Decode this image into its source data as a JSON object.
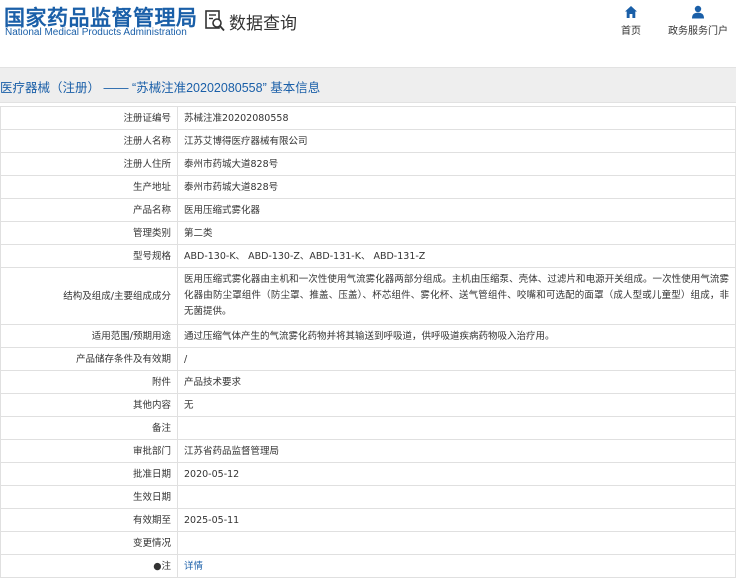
{
  "header": {
    "org_name": "国家药品监督管理局",
    "org_name_en": "National Medical Products Administration",
    "query_label": "数据查询",
    "nav": [
      {
        "label": "首页",
        "icon": "home-icon"
      },
      {
        "label": "政务服务门户",
        "icon": "user-icon"
      }
    ]
  },
  "title": "医疗器械（注册） —— “苏械注准20202080558” 基本信息",
  "colors": {
    "brand_blue": "#1a5fa8",
    "title_bg": "#eeeeee",
    "border": "#e0e0e0"
  },
  "record": [
    {
      "label": "注册证编号",
      "value": "苏械注准20202080558"
    },
    {
      "label": "注册人名称",
      "value": "江苏艾博得医疗器械有限公司"
    },
    {
      "label": "注册人住所",
      "value": "泰州市药城大道828号"
    },
    {
      "label": "生产地址",
      "value": "泰州市药城大道828号"
    },
    {
      "label": "产品名称",
      "value": "医用压缩式雾化器"
    },
    {
      "label": "管理类别",
      "value": "第二类"
    },
    {
      "label": "型号规格",
      "value": "ABD-130-K、 ABD-130-Z、ABD-131-K、 ABD-131-Z"
    },
    {
      "label": "结构及组成/主要组成成分",
      "value": "医用压缩式雾化器由主机和一次性使用气流雾化器两部分组成。主机由压缩泵、壳体、过滤片和电源开关组成。一次性使用气流雾化器由防尘罩组件（防尘罩、推盖、压盖）、杯芯组件、雾化杯、送气管组件、咬嘴和可选配的面罩（成人型或儿童型）组成，非无菌提供。"
    },
    {
      "label": "适用范围/预期用途",
      "value": "通过压缩气体产生的气流雾化药物并将其输送到呼吸道，供呼吸道疾病药物吸入治疗用。"
    },
    {
      "label": "产品储存条件及有效期",
      "value": "/"
    },
    {
      "label": "附件",
      "value": "产品技术要求"
    },
    {
      "label": "其他内容",
      "value": "无"
    },
    {
      "label": "备注",
      "value": ""
    },
    {
      "label": "审批部门",
      "value": "江苏省药品监督管理局"
    },
    {
      "label": "批准日期",
      "value": "2020-05-12"
    },
    {
      "label": "生效日期",
      "value": ""
    },
    {
      "label": "有效期至",
      "value": "2025-05-11"
    },
    {
      "label": "变更情况",
      "value": ""
    },
    {
      "label": "●注",
      "value": "详情"
    }
  ]
}
